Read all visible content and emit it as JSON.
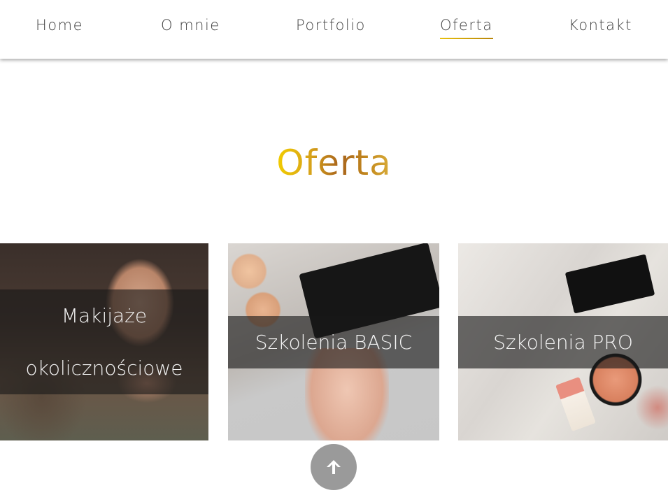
{
  "nav": {
    "items": [
      {
        "label": "Home"
      },
      {
        "label": "O mnie"
      },
      {
        "label": "Portfolio"
      },
      {
        "label": "Oferta",
        "active": true
      },
      {
        "label": "Kontakt"
      }
    ]
  },
  "section": {
    "title": "Oferta",
    "title_gradient": [
      "#f2cd00",
      "#a8641c",
      "#d9ad3a"
    ]
  },
  "cards": [
    {
      "label": "Makijaże okolicznościowe",
      "image": "makeup-application-photo"
    },
    {
      "label": "Szkolenia BASIC",
      "image": "eyeshadow-palette-photo"
    },
    {
      "label": "Szkolenia PRO",
      "image": "cosmetics-flatlay-photo"
    }
  ],
  "scroll_top": {
    "icon": "arrow-up-icon",
    "color": "#9a9a9a"
  },
  "colors": {
    "accent": "#d7a21a",
    "overlay": "rgba(25,25,25,0.62)"
  }
}
